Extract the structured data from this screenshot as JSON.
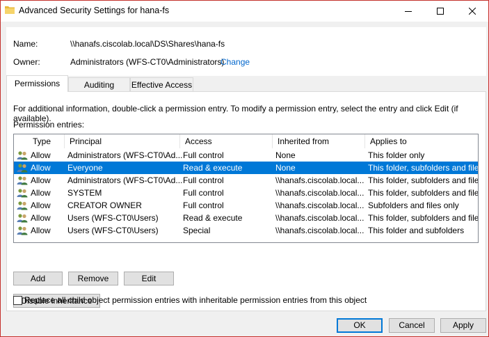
{
  "window": {
    "title": "Advanced Security Settings for hana-fs"
  },
  "info": {
    "name_label": "Name:",
    "name_value": "\\\\hanafs.ciscolab.local\\DS\\Shares\\hana-fs",
    "owner_label": "Owner:",
    "owner_value": "Administrators (WFS-CT0\\Administrators)",
    "change_link": "Change"
  },
  "tabs": [
    {
      "label": "Permissions",
      "active": true
    },
    {
      "label": "Auditing",
      "active": false
    },
    {
      "label": "Effective Access",
      "active": false
    }
  ],
  "permissions": {
    "instructions": "For additional information, double-click a permission entry. To modify a permission entry, select the entry and click Edit (if available).",
    "entries_label": "Permission entries:",
    "columns": [
      "Type",
      "Principal",
      "Access",
      "Inherited from",
      "Applies to"
    ],
    "rows": [
      {
        "type": "Allow",
        "principal": "Administrators (WFS-CT0\\Ad...",
        "access": "Full control",
        "inherited": "None",
        "applies": "This folder only",
        "selected": false
      },
      {
        "type": "Allow",
        "principal": "Everyone",
        "access": "Read & execute",
        "inherited": "None",
        "applies": "This folder, subfolders and files",
        "selected": true
      },
      {
        "type": "Allow",
        "principal": "Administrators (WFS-CT0\\Ad...",
        "access": "Full control",
        "inherited": "\\\\hanafs.ciscolab.local...",
        "applies": "This folder, subfolders and files",
        "selected": false
      },
      {
        "type": "Allow",
        "principal": "SYSTEM",
        "access": "Full control",
        "inherited": "\\\\hanafs.ciscolab.local...",
        "applies": "This folder, subfolders and files",
        "selected": false
      },
      {
        "type": "Allow",
        "principal": "CREATOR OWNER",
        "access": "Full control",
        "inherited": "\\\\hanafs.ciscolab.local...",
        "applies": "Subfolders and files only",
        "selected": false
      },
      {
        "type": "Allow",
        "principal": "Users (WFS-CT0\\Users)",
        "access": "Read & execute",
        "inherited": "\\\\hanafs.ciscolab.local...",
        "applies": "This folder, subfolders and files",
        "selected": false
      },
      {
        "type": "Allow",
        "principal": "Users (WFS-CT0\\Users)",
        "access": "Special",
        "inherited": "\\\\hanafs.ciscolab.local...",
        "applies": "This folder and subfolders",
        "selected": false
      }
    ],
    "buttons": {
      "add": "Add",
      "remove": "Remove",
      "edit": "Edit"
    },
    "disable_inheritance": "Disable inheritance",
    "replace_checkbox_label": "Replace all child object permission entries with inheritable permission entries from this object",
    "replace_checked": false
  },
  "footer": {
    "ok": "OK",
    "cancel": "Cancel",
    "apply": "Apply"
  },
  "icons": {
    "folder": "folder-icon",
    "users": "users-icon",
    "minimize": "minimize-icon",
    "maximize": "maximize-icon",
    "close": "close-icon"
  },
  "colors": {
    "selection": "#0078d7",
    "link": "#0066cc",
    "window_border": "#c4302b"
  }
}
